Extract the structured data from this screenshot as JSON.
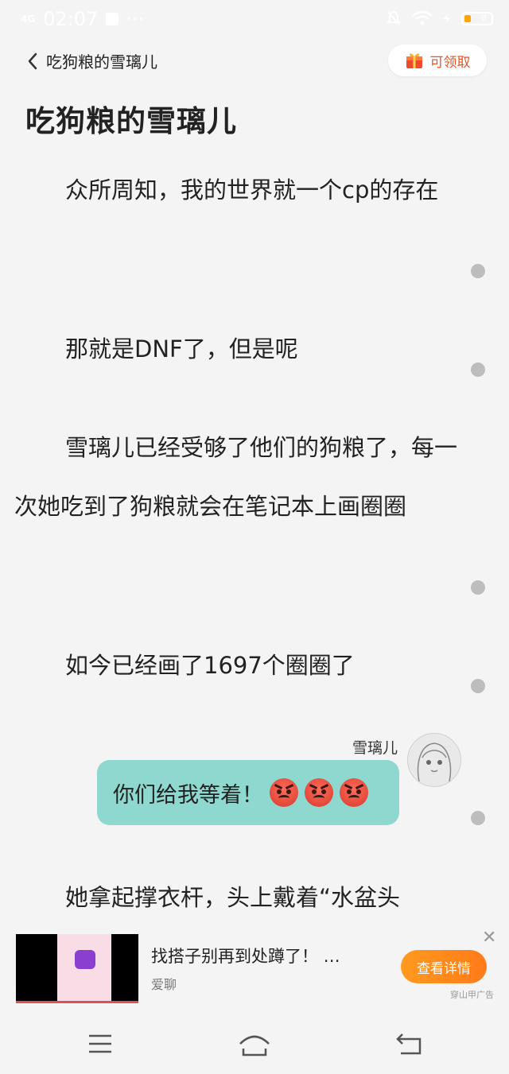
{
  "status_bar": {
    "network": "4G",
    "time": "02:07",
    "more": "···",
    "battery": "8"
  },
  "header": {
    "back_title": "吃狗粮的雪璃儿",
    "claim_label": "可领取"
  },
  "document": {
    "title": "吃狗粮的雪璃儿",
    "paragraphs": [
      "众所周知，我的世界就一个cp的存在",
      "那就是DNF了，但是呢",
      "雪璃儿已经受够了他们的狗粮了，每一次她吃到了狗粮就会在笔记本上画圈圈",
      "如今已经画了1697个圈圈了",
      "她拿起撑衣杆，头上戴着“水盆头"
    ]
  },
  "chat": {
    "speaker": "雪璃儿",
    "message": "你们给我等着！",
    "emoji_icons": [
      "angry-face-icon",
      "angry-face-icon",
      "angry-face-icon"
    ]
  },
  "ad": {
    "title": "找搭子别再到处蹲了！ …",
    "source": "爱聊",
    "cta": "查看详情",
    "label": "穿山甲广告",
    "close": "✕"
  }
}
